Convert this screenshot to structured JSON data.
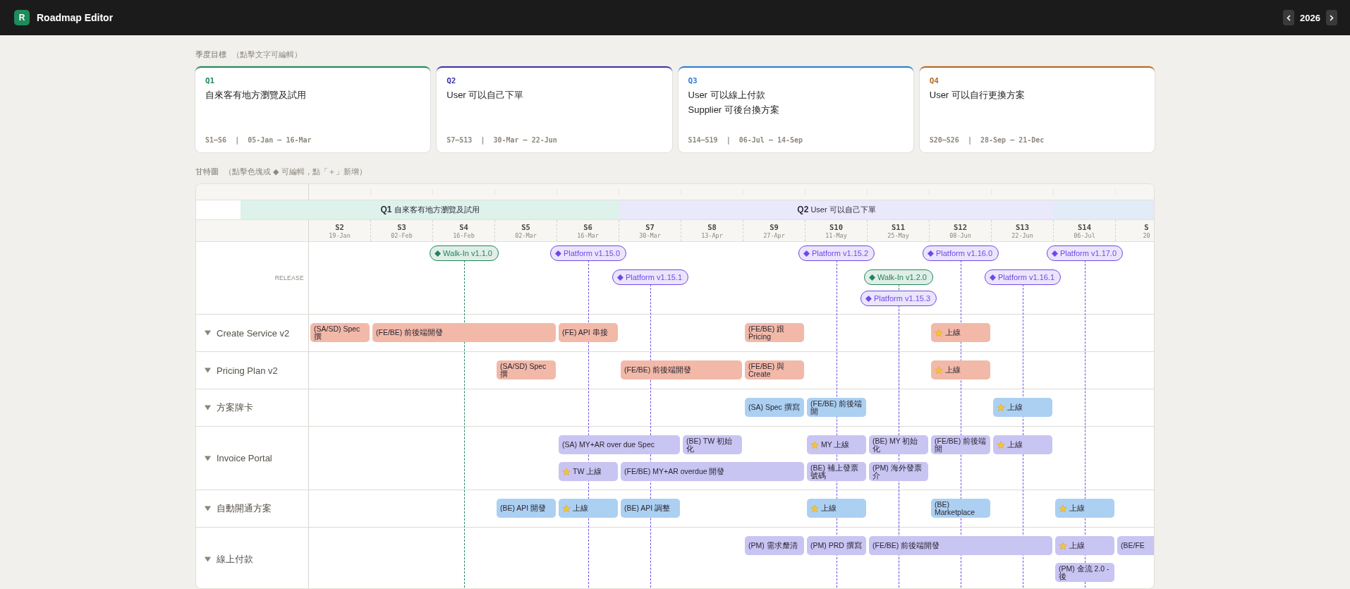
{
  "app": {
    "logo": "R",
    "title": "Roadmap Editor",
    "year": "2026"
  },
  "goals_section": {
    "title": "季度目標",
    "hint": "（點擊文字可編輯）"
  },
  "quarters": [
    {
      "label": "Q1",
      "goal_lines": [
        "自來客有地方瀏覽及試用"
      ],
      "range": "S1–S6  |  05-Jan – 16-Mar",
      "color": "#1f8a5b"
    },
    {
      "label": "Q2",
      "goal_lines": [
        "User 可以自己下單"
      ],
      "range": "S7–S13  |  30-Mar – 22-Jun",
      "color": "#3b35a8"
    },
    {
      "label": "Q3",
      "goal_lines": [
        "User 可以線上付款",
        "Supplier 可後台換方案"
      ],
      "range": "S14–S19  |  06-Jul – 14-Sep",
      "color": "#2b7fd4"
    },
    {
      "label": "Q4",
      "goal_lines": [
        "User 可以自行更換方案"
      ],
      "range": "S20–S26  |  28-Sep – 21-Dec",
      "color": "#b8691e"
    }
  ],
  "gantt": {
    "title": "甘特圖",
    "hint": "（點擊色塊或 ◆ 可編輯，點「＋」新增）",
    "band_slots": [
      {
        "kind": "band",
        "label": "Q1",
        "goal": "自來客有地方瀏覽及試用",
        "clipped_start": true,
        "color": "#dcf2ea"
      },
      {
        "kind": "cont"
      },
      {
        "kind": "cont"
      },
      {
        "kind": "cont"
      },
      {
        "kind": "cont"
      },
      {
        "kind": "band",
        "label": "Q2",
        "goal": "User 可以自己下單",
        "color": "#eae8fb"
      },
      {
        "kind": "cont"
      },
      {
        "kind": "cont"
      },
      {
        "kind": "cont"
      },
      {
        "kind": "cont"
      },
      {
        "kind": "cont"
      },
      {
        "kind": "cont"
      },
      {
        "kind": "band",
        "color": "#e1ecf8"
      },
      {
        "kind": "cont"
      }
    ],
    "weeks": [
      {
        "label": "S2",
        "date": "19-Jan"
      },
      {
        "label": "S3",
        "date": "02-Feb"
      },
      {
        "label": "S4",
        "date": "16-Feb"
      },
      {
        "label": "S5",
        "date": "02-Mar"
      },
      {
        "label": "S6",
        "date": "16-Mar"
      },
      {
        "label": "S7",
        "date": "30-Mar"
      },
      {
        "label": "S8",
        "date": "13-Apr"
      },
      {
        "label": "S9",
        "date": "27-Apr"
      },
      {
        "label": "S10",
        "date": "11-May"
      },
      {
        "label": "S11",
        "date": "25-May"
      },
      {
        "label": "S12",
        "date": "08-Jun"
      },
      {
        "label": "S13",
        "date": "22-Jun"
      },
      {
        "label": "S14",
        "date": "06-Jul"
      },
      {
        "label": "S",
        "date": "20"
      }
    ],
    "release_label": "RELEASE",
    "release_tiers": [
      [
        {
          "kind": "gap"
        },
        {
          "kind": "gap"
        },
        {
          "kind": "release",
          "name": "Walk-In v1.1.0",
          "color": "#23845a"
        },
        {
          "kind": "gap"
        },
        {
          "kind": "release",
          "name": "Platform v1.15.0",
          "color": "#7048e8"
        },
        {
          "kind": "gap"
        },
        {
          "kind": "gap"
        },
        {
          "kind": "gap"
        },
        {
          "kind": "release",
          "name": "Platform v1.15.2",
          "color": "#7048e8"
        },
        {
          "kind": "gap"
        },
        {
          "kind": "release",
          "name": "Platform v1.16.0",
          "color": "#7048e8"
        },
        {
          "kind": "gap"
        },
        {
          "kind": "release",
          "name": "Platform v1.17.0",
          "color": "#7048e8"
        }
      ],
      [
        {
          "kind": "gap"
        },
        {
          "kind": "gap"
        },
        {
          "kind": "gap"
        },
        {
          "kind": "gap"
        },
        {
          "kind": "gap"
        },
        {
          "kind": "release",
          "name": "Platform v1.15.1",
          "color": "#7048e8"
        },
        {
          "kind": "gap"
        },
        {
          "kind": "gap"
        },
        {
          "kind": "gap"
        },
        {
          "kind": "release",
          "name": "Walk-In v1.2.0",
          "color": "#23845a"
        },
        {
          "kind": "gap"
        },
        {
          "kind": "release",
          "name": "Platform v1.16.1",
          "color": "#7048e8"
        }
      ],
      [
        {
          "kind": "gap"
        },
        {
          "kind": "gap"
        },
        {
          "kind": "gap"
        },
        {
          "kind": "gap"
        },
        {
          "kind": "gap"
        },
        {
          "kind": "gap"
        },
        {
          "kind": "gap"
        },
        {
          "kind": "gap"
        },
        {
          "kind": "gap"
        },
        {
          "kind": "release",
          "name": "Platform v1.15.3",
          "color": "#7048e8"
        }
      ]
    ],
    "projects": [
      {
        "name": "Create Service v2",
        "expanded": true,
        "color": "#f2b9a9",
        "lanes": [
          [
            {
              "kind": "task",
              "text": "(SA/SD) Spec 撰",
              "star": false
            },
            {
              "kind": "task",
              "text": "(FE/BE) 前後端開發",
              "star": false
            },
            {
              "kind": "cont"
            },
            {
              "kind": "cont"
            },
            {
              "kind": "task",
              "text": "(FE) API 串接",
              "star": false
            },
            {
              "kind": "gap"
            },
            {
              "kind": "gap"
            },
            {
              "kind": "task",
              "text": "(FE/BE) 跟 Pricing",
              "star": false
            },
            {
              "kind": "gap"
            },
            {
              "kind": "gap"
            },
            {
              "kind": "task",
              "text": "上線",
              "star": true
            }
          ]
        ]
      },
      {
        "name": "Pricing Plan v2",
        "expanded": true,
        "color": "#f2b9a9",
        "lanes": [
          [
            {
              "kind": "gap"
            },
            {
              "kind": "gap"
            },
            {
              "kind": "gap"
            },
            {
              "kind": "task",
              "text": "(SA/SD) Spec 撰",
              "star": false
            },
            {
              "kind": "gap"
            },
            {
              "kind": "task",
              "text": "(FE/BE) 前後端開發",
              "star": false
            },
            {
              "kind": "cont"
            },
            {
              "kind": "task",
              "text": "(FE/BE) 與 Create",
              "star": false
            },
            {
              "kind": "gap"
            },
            {
              "kind": "gap"
            },
            {
              "kind": "task",
              "text": "上線",
              "star": true
            }
          ]
        ]
      },
      {
        "name": "方案牌卡",
        "expanded": true,
        "color": "#acd0f1",
        "lanes": [
          [
            {
              "kind": "gap"
            },
            {
              "kind": "gap"
            },
            {
              "kind": "gap"
            },
            {
              "kind": "gap"
            },
            {
              "kind": "gap"
            },
            {
              "kind": "gap"
            },
            {
              "kind": "gap"
            },
            {
              "kind": "task",
              "text": "(SA) Spec 撰寫",
              "star": false
            },
            {
              "kind": "task",
              "text": "(FE/BE) 前後端開",
              "star": false
            },
            {
              "kind": "gap"
            },
            {
              "kind": "gap"
            },
            {
              "kind": "task",
              "text": "上線",
              "star": true
            }
          ]
        ]
      },
      {
        "name": "Invoice Portal",
        "expanded": true,
        "color": "#c8c5f3",
        "lanes": [
          [
            {
              "kind": "gap"
            },
            {
              "kind": "gap"
            },
            {
              "kind": "gap"
            },
            {
              "kind": "gap"
            },
            {
              "kind": "task",
              "text": "(SA) MY+AR over due Spec",
              "star": false
            },
            {
              "kind": "cont"
            },
            {
              "kind": "task",
              "text": "(BE) TW 初始化",
              "star": false
            },
            {
              "kind": "gap"
            },
            {
              "kind": "task",
              "text": "MY 上線",
              "star": true
            },
            {
              "kind": "task",
              "text": "(BE) MY 初始化",
              "star": false
            },
            {
              "kind": "task",
              "text": "(FE/BE) 前後端開",
              "star": false
            },
            {
              "kind": "task",
              "text": "上線",
              "star": true
            }
          ],
          [
            {
              "kind": "gap"
            },
            {
              "kind": "gap"
            },
            {
              "kind": "gap"
            },
            {
              "kind": "gap"
            },
            {
              "kind": "task",
              "text": "TW 上線",
              "star": true
            },
            {
              "kind": "task",
              "text": "(FE/BE) MY+AR overdue 開發",
              "star": false
            },
            {
              "kind": "cont"
            },
            {
              "kind": "cont"
            },
            {
              "kind": "task",
              "text": "(BE) 補上發票號碼",
              "star": false
            },
            {
              "kind": "task",
              "text": "(PM) 海外發票介",
              "star": false
            }
          ]
        ]
      },
      {
        "name": "自動開通方案",
        "expanded": true,
        "color": "#acd0f1",
        "lanes": [
          [
            {
              "kind": "gap"
            },
            {
              "kind": "gap"
            },
            {
              "kind": "gap"
            },
            {
              "kind": "task",
              "text": "(BE) API 開發",
              "star": false
            },
            {
              "kind": "task",
              "text": "上線",
              "star": true
            },
            {
              "kind": "task",
              "text": "(BE) API 調整",
              "star": false
            },
            {
              "kind": "gap"
            },
            {
              "kind": "gap"
            },
            {
              "kind": "task",
              "text": "上線",
              "star": true
            },
            {
              "kind": "gap"
            },
            {
              "kind": "task",
              "text": "(BE) Marketplace",
              "star": false
            },
            {
              "kind": "gap"
            },
            {
              "kind": "task",
              "text": "上線",
              "star": true
            }
          ]
        ]
      },
      {
        "name": "線上付款",
        "expanded": true,
        "color": "#c8c5f3",
        "lanes": [
          [
            {
              "kind": "gap"
            },
            {
              "kind": "gap"
            },
            {
              "kind": "gap"
            },
            {
              "kind": "gap"
            },
            {
              "kind": "gap"
            },
            {
              "kind": "gap"
            },
            {
              "kind": "gap"
            },
            {
              "kind": "task",
              "text": "(PM) 需求釐清",
              "star": false
            },
            {
              "kind": "task",
              "text": "(PM) PRD 撰寫",
              "star": false
            },
            {
              "kind": "task",
              "text": "(FE/BE) 前後端開發",
              "star": false
            },
            {
              "kind": "cont"
            },
            {
              "kind": "cont"
            },
            {
              "kind": "task",
              "text": "上線",
              "star": true
            },
            {
              "kind": "task",
              "text": "(BE/FE",
              "star": false
            }
          ],
          [
            {
              "kind": "gap"
            },
            {
              "kind": "gap"
            },
            {
              "kind": "gap"
            },
            {
              "kind": "gap"
            },
            {
              "kind": "gap"
            },
            {
              "kind": "gap"
            },
            {
              "kind": "gap"
            },
            {
              "kind": "gap"
            },
            {
              "kind": "gap"
            },
            {
              "kind": "gap"
            },
            {
              "kind": "gap"
            },
            {
              "kind": "gap"
            },
            {
              "kind": "task",
              "text": "(PM) 金流 2.0 - 後",
              "star": false
            }
          ]
        ]
      }
    ]
  }
}
